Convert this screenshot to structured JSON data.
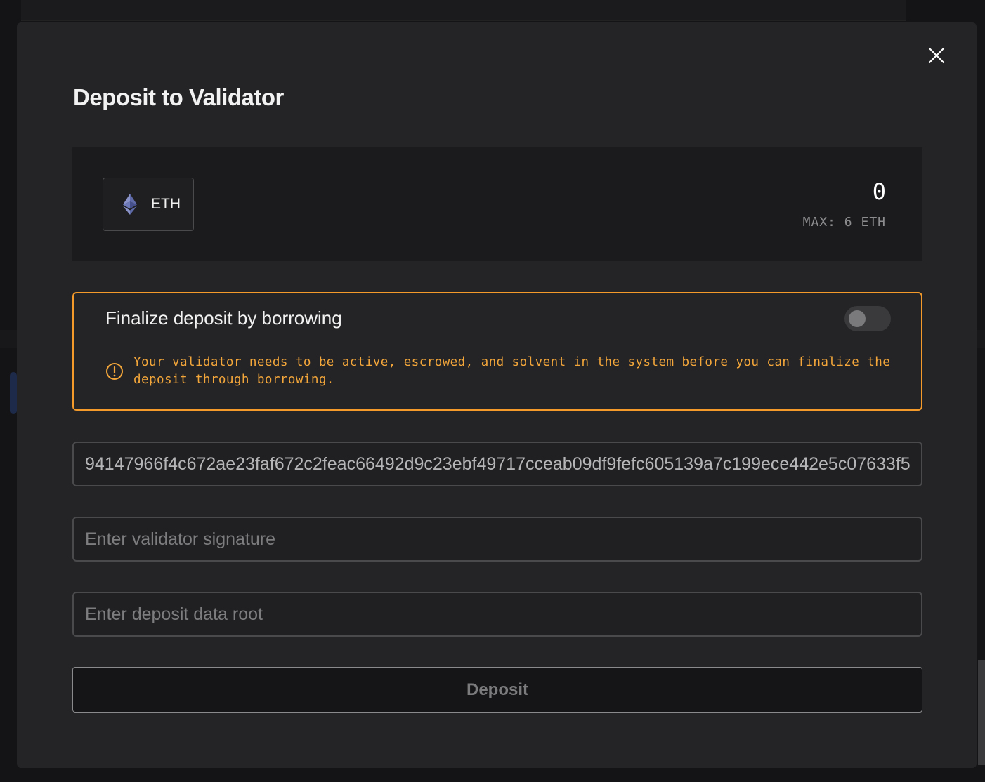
{
  "modal": {
    "title": "Deposit to Validator",
    "close_icon": "close-icon"
  },
  "amount": {
    "token": "ETH",
    "token_icon": "ethereum-icon",
    "value": "0",
    "max_label": "MAX: 6 ETH"
  },
  "borrow": {
    "title": "Finalize deposit by borrowing",
    "toggle_on": false,
    "warning_icon": "warning-circle-icon",
    "warning_text": "Your validator needs to be active, escrowed, and solvent in the system before you can finalize the deposit through borrowing.",
    "accent_color": "#f39a2b"
  },
  "fields": {
    "pubkey_value": "94147966f4c672ae23faf672c2feac66492d9c23ebf49717cceab09df9fefc605139a7c199ece442e5c07633f5",
    "signature_placeholder": "Enter validator signature",
    "deposit_root_placeholder": "Enter deposit data root"
  },
  "actions": {
    "deposit_label": "Deposit"
  }
}
